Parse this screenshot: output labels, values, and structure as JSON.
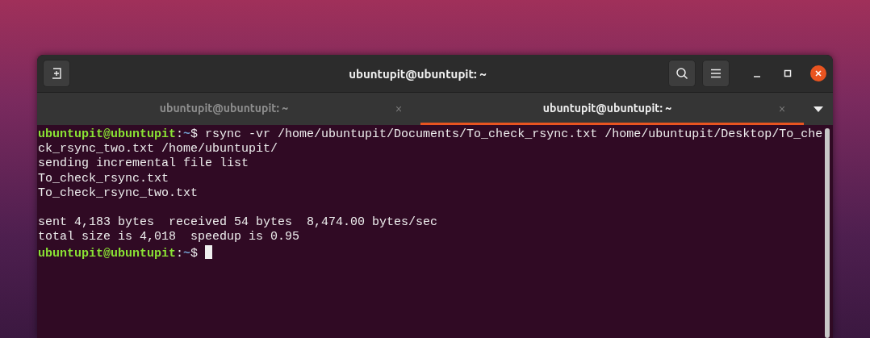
{
  "window": {
    "title": "ubuntupit@ubuntupit: ~"
  },
  "tabs": [
    {
      "label": "ubuntupit@ubuntupit: ~",
      "close": "×",
      "selected": false
    },
    {
      "label": "ubuntupit@ubuntupit: ~",
      "close": "×",
      "selected": true
    }
  ],
  "terminal": {
    "lines": [
      {
        "kind": "prompt",
        "user": "ubuntupit@ubuntupit",
        "separator": ":",
        "path": "~",
        "sign": "$",
        "command": "rsync -vr /home/ubuntupit/Documents/To_check_rsync.txt /home/ubuntupit/Desktop/To_che"
      },
      {
        "kind": "output",
        "text": "ck_rsync_two.txt /home/ubuntupit/"
      },
      {
        "kind": "output",
        "text": "sending incremental file list"
      },
      {
        "kind": "output",
        "text": "To_check_rsync.txt"
      },
      {
        "kind": "output",
        "text": "To_check_rsync_two.txt"
      },
      {
        "kind": "blank"
      },
      {
        "kind": "output",
        "text": "sent 4,183 bytes  received 54 bytes  8,474.00 bytes/sec"
      },
      {
        "kind": "output",
        "text": "total size is 4,018  speedup is 0.95"
      },
      {
        "kind": "prompt",
        "user": "ubuntupit@ubuntupit",
        "separator": ":",
        "path": "~",
        "sign": "$",
        "cursor": true
      }
    ]
  }
}
